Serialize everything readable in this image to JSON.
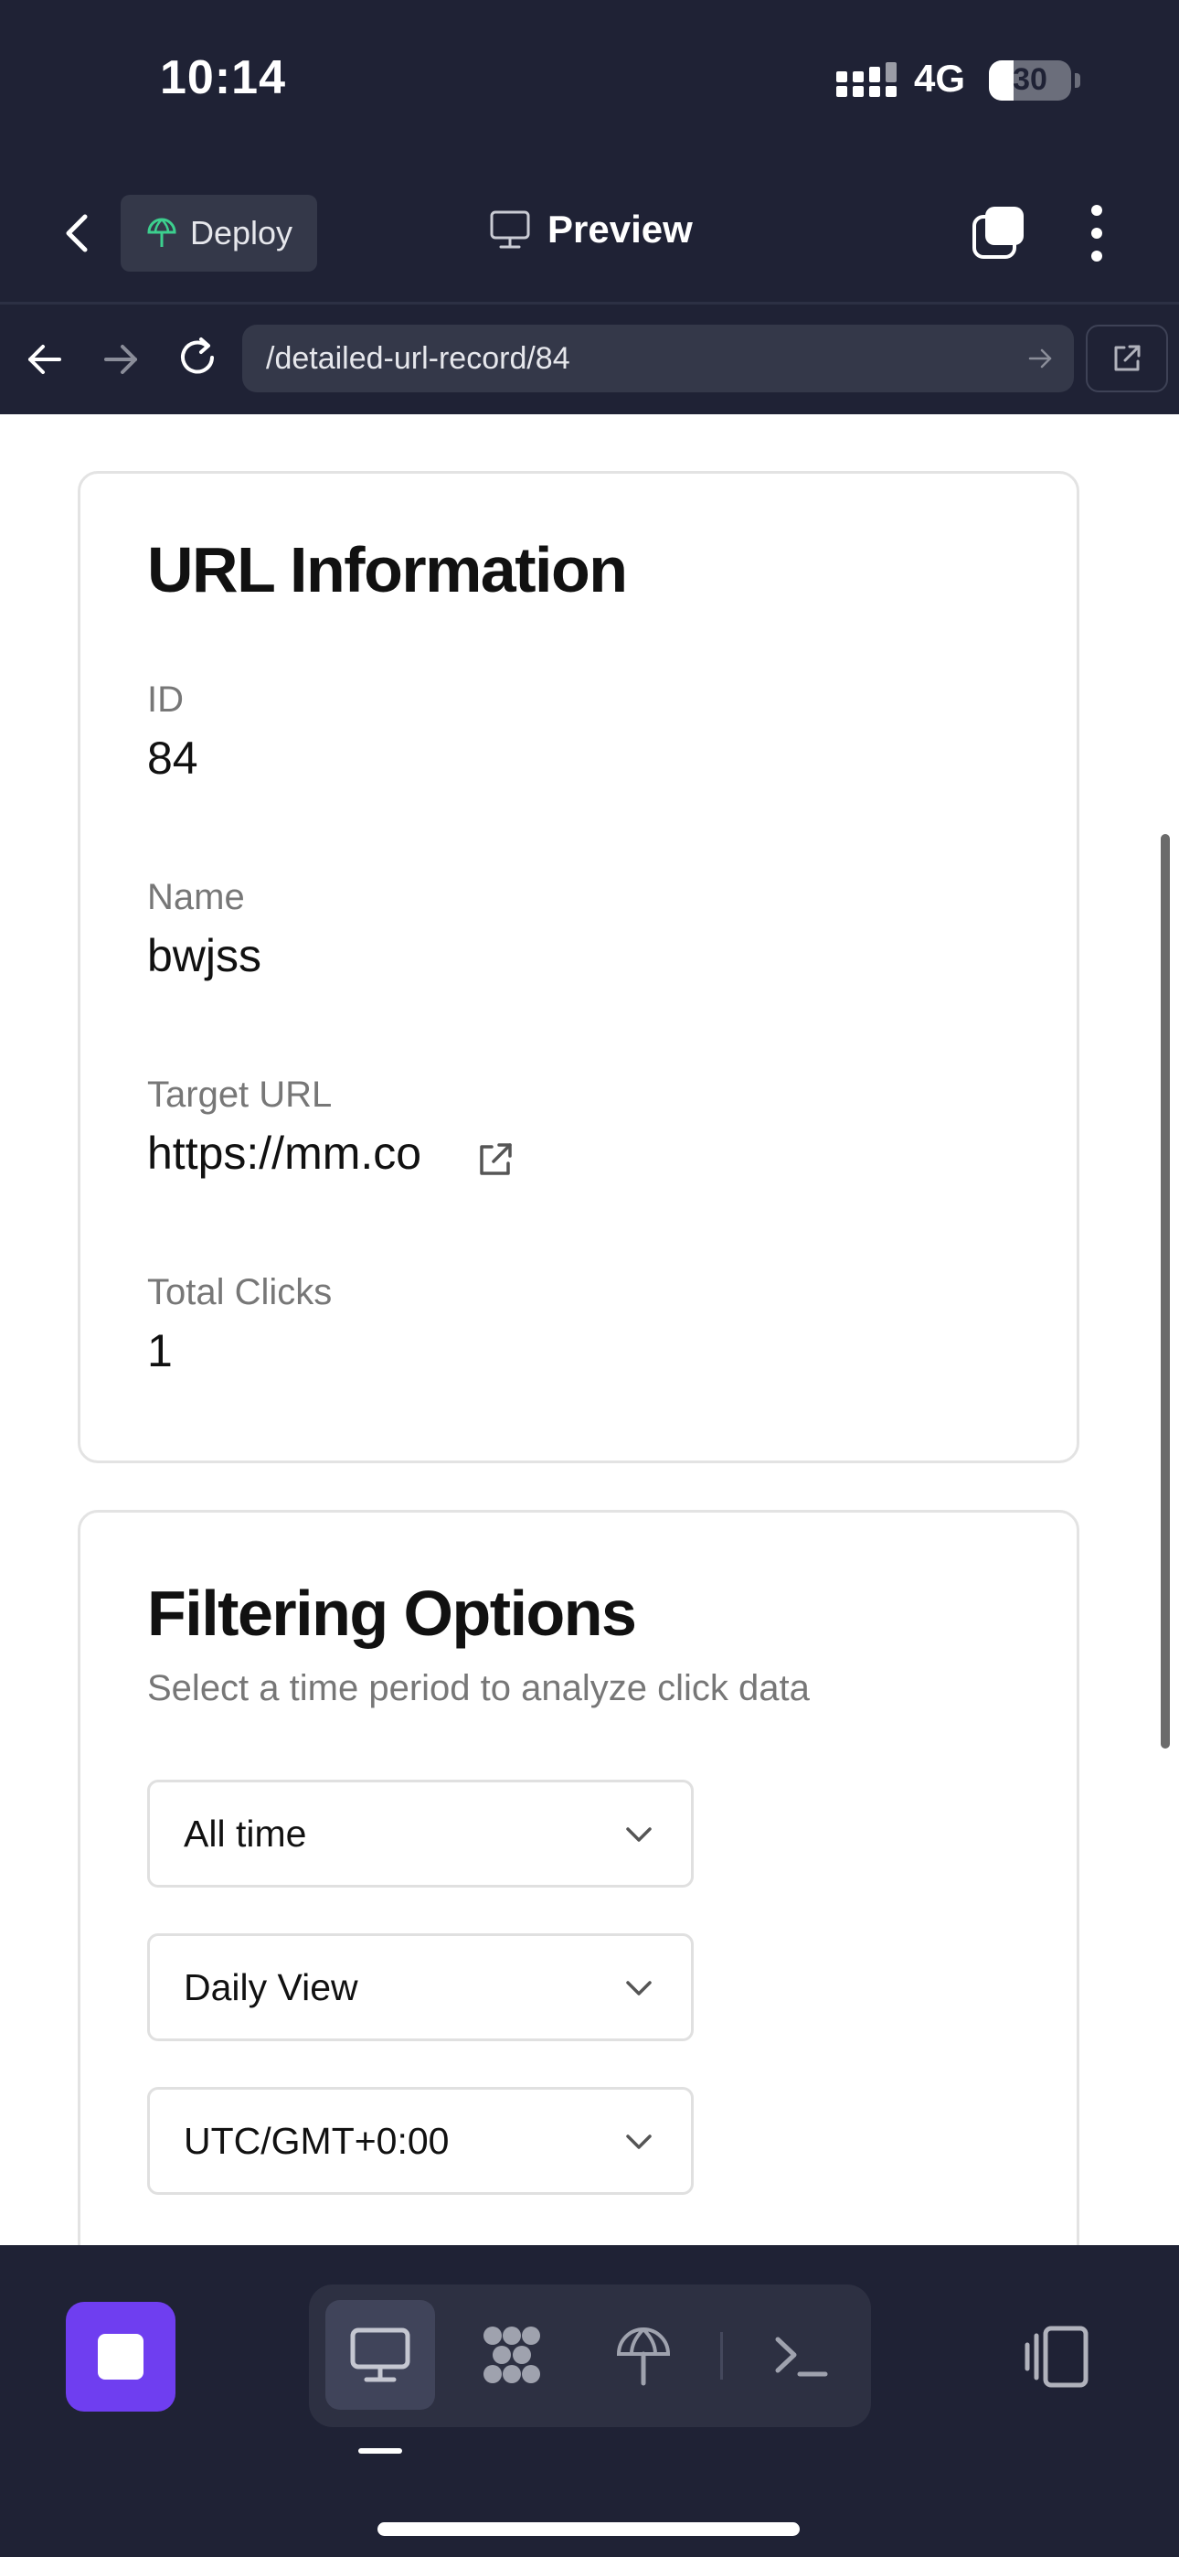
{
  "status_bar": {
    "time": "10:14",
    "network": "4G",
    "battery": "30"
  },
  "header": {
    "deploy_label": "Deploy",
    "preview_label": "Preview"
  },
  "browser": {
    "url": "/detailed-url-record/84"
  },
  "url_info": {
    "title": "URL Information",
    "fields": [
      {
        "label": "ID",
        "value": "84"
      },
      {
        "label": "Name",
        "value": "bwjss"
      },
      {
        "label": "Target URL",
        "value": "https://mm.co"
      },
      {
        "label": "Total Clicks",
        "value": "1"
      }
    ]
  },
  "filtering": {
    "title": "Filtering Options",
    "subtitle": "Select a time period to analyze click data",
    "selects": [
      {
        "value": "All time"
      },
      {
        "value": "Daily View"
      },
      {
        "value": "UTC/GMT+0:00"
      }
    ]
  },
  "icons": {
    "back": "chevron-left-icon",
    "deploy": "globe-antenna-icon",
    "preview": "monitor-icon",
    "tabs": "tabs-icon",
    "menu": "more-vertical-icon",
    "nav_back": "arrow-left-icon",
    "nav_forward": "arrow-right-icon",
    "reload": "reload-icon",
    "open_external": "external-link-icon",
    "select_chevron": "chevron-down-icon",
    "stop": "stop-icon",
    "tool_preview": "monitor-icon",
    "tool_integrations": "puzzle-icon",
    "tool_deploy": "globe-antenna-icon",
    "tool_console": "terminal-icon",
    "layout": "split-layout-icon"
  },
  "colors": {
    "accent": "#6f3ef0",
    "chrome": "#1f2235"
  }
}
